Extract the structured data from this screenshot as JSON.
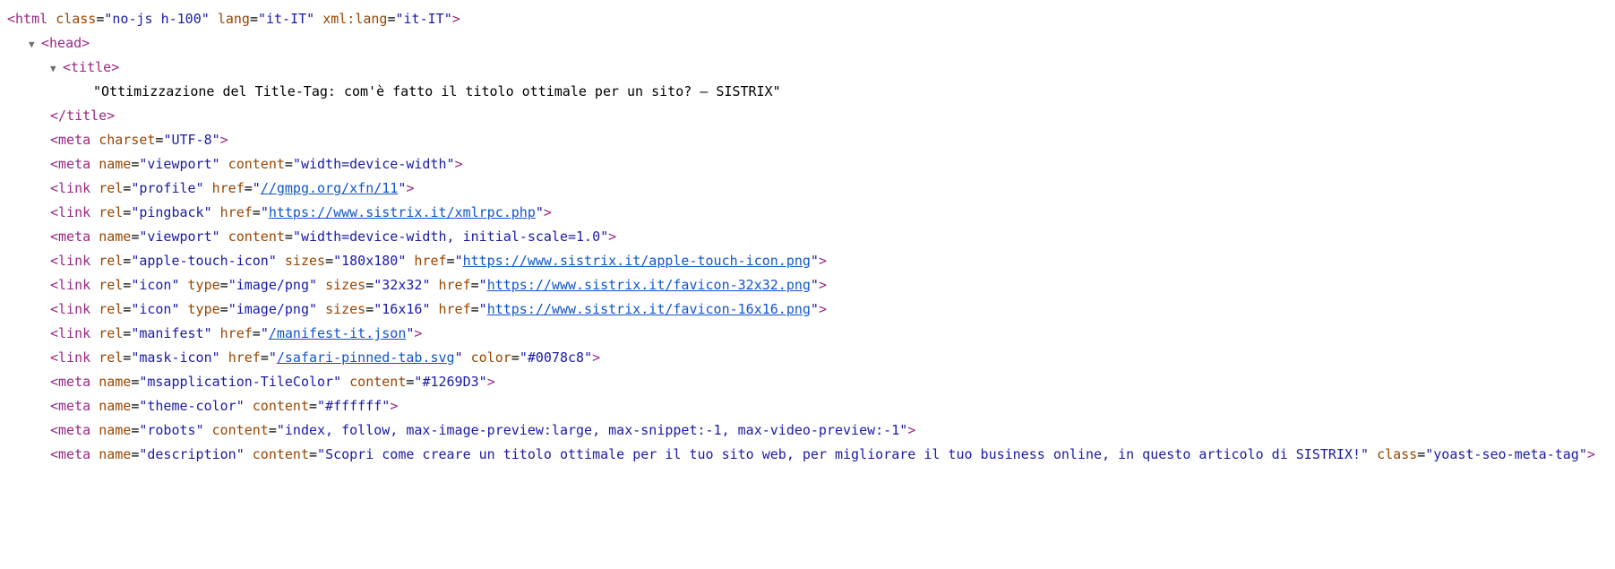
{
  "html_tag": {
    "class": "no-js h-100",
    "lang": "it-IT",
    "xmllang": "it-IT"
  },
  "title_text": "\"Ottimizzazione del Title-Tag: com'è fatto il titolo ottimale per un sito? – SISTRIX\"",
  "meta_charset": "UTF-8",
  "meta_viewport1": {
    "name": "viewport",
    "content": "width=device-width"
  },
  "link_profile": {
    "rel": "profile",
    "href": "//gmpg.org/xfn/11"
  },
  "link_pingback": {
    "rel": "pingback",
    "href": "https://www.sistrix.it/xmlrpc.php"
  },
  "meta_viewport2": {
    "name": "viewport",
    "content": "width=device-width, initial-scale=1.0"
  },
  "link_apple": {
    "rel": "apple-touch-icon",
    "sizes": "180x180",
    "href": "https://www.sistrix.it/apple-touch-icon.png"
  },
  "link_icon32": {
    "rel": "icon",
    "type": "image/png",
    "sizes": "32x32",
    "href": "https://www.sistrix.it/favicon-32x32.png"
  },
  "link_icon16": {
    "rel": "icon",
    "type": "image/png",
    "sizes": "16x16",
    "href": "https://www.sistrix.it/favicon-16x16.png"
  },
  "link_manifest": {
    "rel": "manifest",
    "href": "/manifest-it.json"
  },
  "link_mask": {
    "rel": "mask-icon",
    "href": "/safari-pinned-tab.svg",
    "color": "#0078c8"
  },
  "meta_tilecolor": {
    "name": "msapplication-TileColor",
    "content": "#1269D3"
  },
  "meta_themecolor": {
    "name": "theme-color",
    "content": "#ffffff"
  },
  "meta_robots": {
    "name": "robots",
    "content": "index, follow, max-image-preview:large, max-snippet:-1, max-video-preview:-1"
  },
  "meta_description": {
    "name": "description",
    "content": "Scopri come creare un titolo ottimale per il tuo sito web, per migliorare il tuo business online, in questo articolo di SISTRIX!",
    "class": "yoast-seo-meta-tag"
  }
}
